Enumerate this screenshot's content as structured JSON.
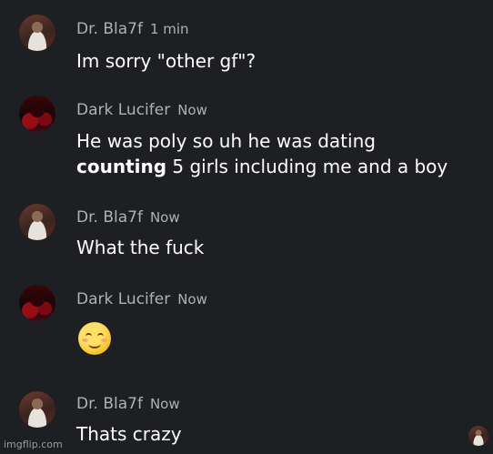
{
  "messages": [
    {
      "avatar_icon": "user-avatar-dr-bla7f",
      "username": "Dr. Bla7f",
      "time": "1 min",
      "lines": [
        "Im sorry \"other gf\"?"
      ]
    },
    {
      "avatar_icon": "user-avatar-dark-lucifer",
      "username": "Dark Lucifer",
      "time": "Now",
      "lines": [
        "He was poly so uh he was dating"
      ],
      "line2_bold": "counting",
      "line2_rest": " 5 girls including me and a boy"
    },
    {
      "avatar_icon": "user-avatar-dr-bla7f",
      "username": "Dr. Bla7f",
      "time": "Now",
      "lines": [
        "What the fuck"
      ]
    },
    {
      "avatar_icon": "user-avatar-dark-lucifer",
      "username": "Dark Lucifer",
      "time": "Now",
      "emoji": "smiling-face-with-smiling-eyes"
    },
    {
      "avatar_icon": "user-avatar-dr-bla7f",
      "username": "Dr. Bla7f",
      "time": "Now",
      "lines": [
        "Thats crazy"
      ]
    }
  ],
  "watermark": "imgflip.com",
  "colors": {
    "background": "#1e1f23",
    "username": "#aeb1b8",
    "message_text": "#ffffff"
  }
}
